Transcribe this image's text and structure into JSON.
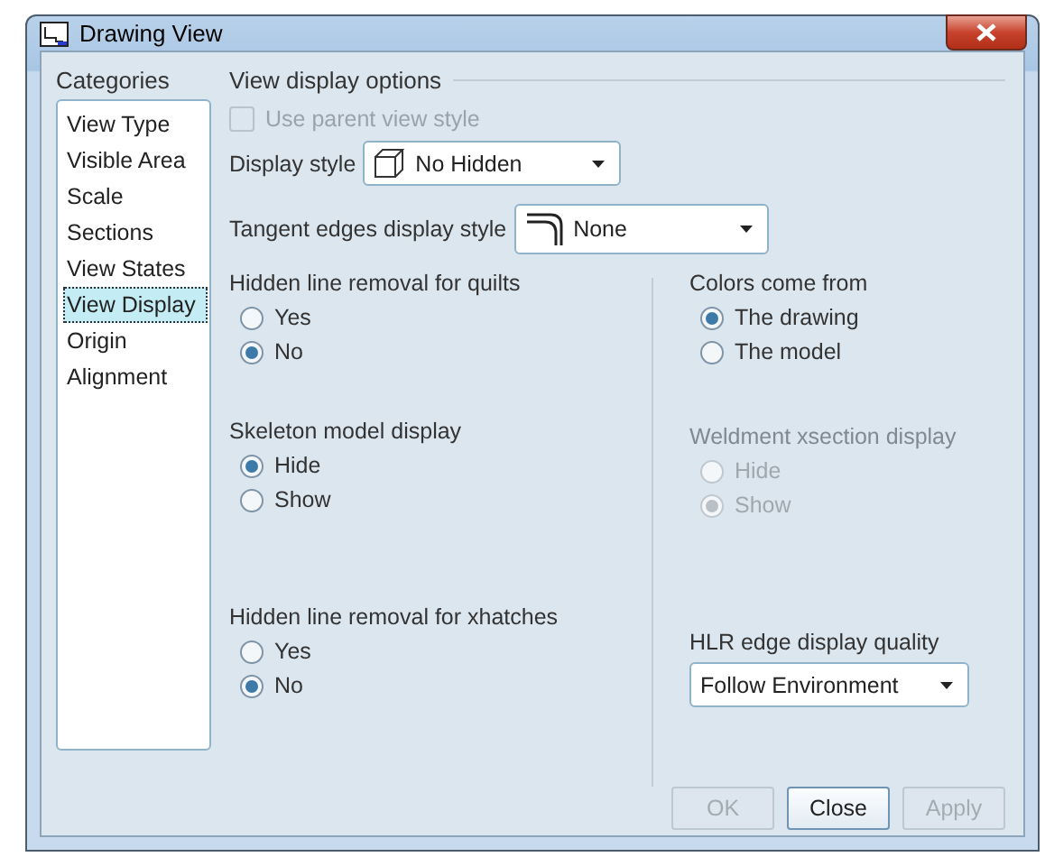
{
  "window": {
    "title": "Drawing View"
  },
  "categories": {
    "title": "Categories",
    "items": [
      {
        "label": "View Type",
        "selected": false
      },
      {
        "label": "Visible Area",
        "selected": false
      },
      {
        "label": "Scale",
        "selected": false
      },
      {
        "label": "Sections",
        "selected": false
      },
      {
        "label": "View States",
        "selected": false
      },
      {
        "label": "View Display",
        "selected": true
      },
      {
        "label": "Origin",
        "selected": false
      },
      {
        "label": "Alignment",
        "selected": false
      }
    ]
  },
  "options": {
    "title": "View display options",
    "use_parent": {
      "label": "Use parent view style",
      "checked": false,
      "disabled": true
    },
    "display_style": {
      "label": "Display style",
      "value": "No Hidden"
    },
    "tangent_edges": {
      "label": "Tangent edges display style",
      "value": "None"
    }
  },
  "left_groups": [
    {
      "kind": "radio",
      "title": "Hidden line removal for quilts",
      "disabled": false,
      "options": [
        {
          "label": "Yes",
          "selected": false
        },
        {
          "label": "No",
          "selected": true
        }
      ]
    },
    {
      "kind": "radio",
      "title": "Skeleton model display",
      "disabled": false,
      "options": [
        {
          "label": "Hide",
          "selected": true
        },
        {
          "label": "Show",
          "selected": false
        }
      ]
    },
    {
      "kind": "radio",
      "title": "Hidden line removal for xhatches",
      "disabled": false,
      "options": [
        {
          "label": "Yes",
          "selected": false
        },
        {
          "label": "No",
          "selected": true
        }
      ]
    }
  ],
  "right_groups": [
    {
      "kind": "radio",
      "title": "Colors come from",
      "disabled": false,
      "options": [
        {
          "label": "The drawing",
          "selected": true
        },
        {
          "label": "The model",
          "selected": false
        }
      ]
    },
    {
      "kind": "radio",
      "title": "Weldment xsection display",
      "disabled": true,
      "options": [
        {
          "label": "Hide",
          "selected": false
        },
        {
          "label": "Show",
          "selected": true
        }
      ]
    },
    {
      "kind": "dropdown",
      "title": "HLR edge display quality",
      "value": "Follow Environment"
    }
  ],
  "buttons": [
    {
      "label": "OK",
      "disabled": true
    },
    {
      "label": "Close",
      "disabled": false
    },
    {
      "label": "Apply",
      "disabled": true
    }
  ]
}
